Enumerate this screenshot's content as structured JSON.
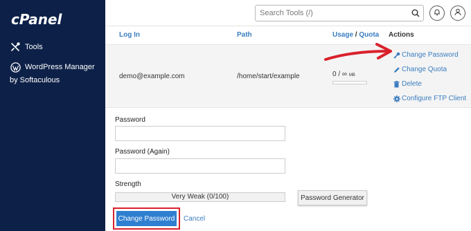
{
  "sidebar": {
    "logo": "cPanel",
    "items": [
      {
        "label": "Tools",
        "icon": "tools-icon"
      },
      {
        "label": "WordPress Manager",
        "icon": "wordpress-icon"
      }
    ],
    "wp_sub": "by Softaculous"
  },
  "header": {
    "search_placeholder": "Search Tools (/)",
    "icons": [
      "search-icon",
      "bell-icon",
      "user-icon"
    ]
  },
  "table": {
    "columns": {
      "login": "Log In",
      "path": "Path",
      "usage": "Usage",
      "usage_sep": "/",
      "quota": "Quota",
      "actions": "Actions"
    },
    "row": {
      "login": "demo@example.com",
      "path": "/home/start/example",
      "usage_value": "0 / ∞",
      "usage_unit": "MB",
      "usage_fraction": 0
    },
    "actions": [
      {
        "label": "Change Password",
        "icon": "key-icon"
      },
      {
        "label": "Change Quota",
        "icon": "pencil-icon"
      },
      {
        "label": "Delete",
        "icon": "trash-icon"
      },
      {
        "label": "Configure FTP Client",
        "icon": "gear-icon"
      }
    ]
  },
  "form": {
    "password_label": "Password",
    "password_again_label": "Password (Again)",
    "strength_label": "Strength",
    "strength_value": "Very Weak (0/100)",
    "generator_button": "Password Generator",
    "submit_button": "Change Password",
    "cancel_link": "Cancel"
  },
  "colors": {
    "sidebar_bg": "#0d2148",
    "link": "#3a7dc0",
    "primary": "#2f7fd0",
    "annotation_red": "#d9212c"
  }
}
